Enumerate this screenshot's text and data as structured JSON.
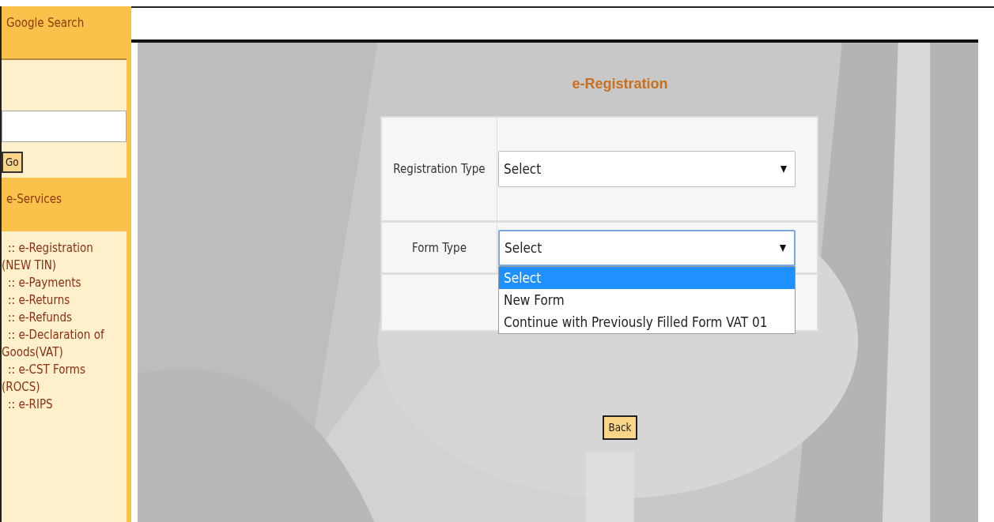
{
  "sidebar": {
    "search_header": "Google Search",
    "go_button": "Go",
    "services_header": "e-Services",
    "links": [
      ":: e-Registration (NEW TIN)",
      ":: e-Payments",
      ":: e-Returns",
      ":: e-Refunds",
      ":: e-Declaration of Goods(VAT)",
      ":: e-CST Forms (ROCS)",
      ":: e-RIPS"
    ]
  },
  "main": {
    "title": "e-Registration",
    "fields": [
      {
        "label": "Registration Type",
        "value": "Select",
        "expanded": false
      },
      {
        "label": "Form Type",
        "value": "Select",
        "expanded": true,
        "options": [
          {
            "label": "Select",
            "selected": true
          },
          {
            "label": "New Form",
            "selected": false
          },
          {
            "label": "Continue with Previously Filled Form VAT 01",
            "selected": false
          }
        ]
      }
    ],
    "back_button": "Back"
  }
}
